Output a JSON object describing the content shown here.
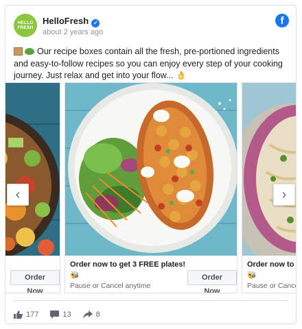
{
  "post": {
    "page_name": "HelloFresh",
    "avatar_line1": "HELLO",
    "avatar_line2": "FRESH",
    "timestamp": "about 2 years ago",
    "text_main": "Our recipe boxes contain all the fresh, pre-portioned ingredients and easy-to-follow recipes so you can enjoy every step of your cooking journey. Just relax and get into your flow...",
    "icons": {
      "verified": "verified-badge-icon",
      "platform": "facebook-logo-icon",
      "emoji_start_1": "package-emoji-icon",
      "emoji_start_2": "leafy-green-emoji-icon",
      "emoji_end": "ok-hand-emoji-icon"
    }
  },
  "carousel": {
    "cards": [
      {
        "caption": "",
        "subtext": "",
        "cta_label": "Order Now"
      },
      {
        "caption": "Order now to get 3 FREE plates!",
        "caption_icon": "bee-emoji-icon",
        "subtext": "Pause or Cancel anytime",
        "cta_label": "Order Now"
      },
      {
        "caption": "Order now to g",
        "caption_icon": "bee-emoji-icon",
        "subtext": "Pause or Cance",
        "cta_label": ""
      }
    ],
    "prev_icon": "chevron-left-icon",
    "next_icon": "chevron-right-icon"
  },
  "engagement": {
    "likes": "177",
    "comments": "13",
    "shares": "8"
  },
  "colors": {
    "brand_green": "#8cc63f",
    "facebook_blue": "#1877f2",
    "text_primary": "#1c1e21",
    "text_secondary": "#606770"
  }
}
